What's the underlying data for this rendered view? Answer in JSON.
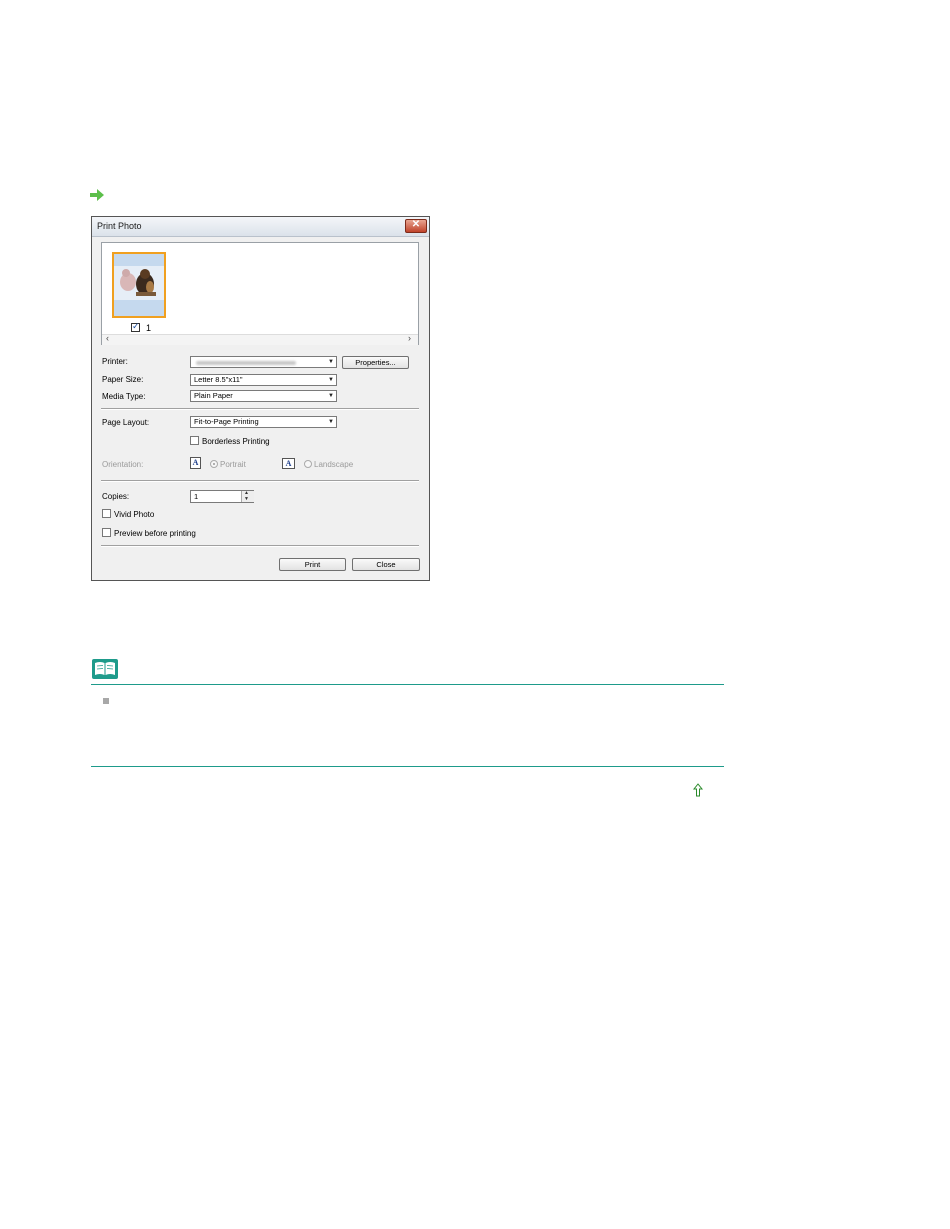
{
  "dialog": {
    "title": "Print Photo",
    "close_glyph": "✕",
    "thumbnail": {
      "number": "1",
      "checked": true,
      "check_glyph": "✓",
      "scroll_left": "‹",
      "scroll_right": "›"
    },
    "printer": {
      "label": "Printer:",
      "value": "",
      "properties_button": "Properties..."
    },
    "paper_size": {
      "label": "Paper Size:",
      "value": "Letter 8.5\"x11\""
    },
    "media_type": {
      "label": "Media Type:",
      "value": "Plain Paper"
    },
    "page_layout": {
      "label": "Page Layout:",
      "value": "Fit-to-Page Printing"
    },
    "borderless": {
      "label": "Borderless Printing",
      "checked": false
    },
    "orientation": {
      "label": "Orientation:",
      "portrait": "Portrait",
      "landscape": "Landscape",
      "icon_letter": "A",
      "selected": "Portrait"
    },
    "copies": {
      "label": "Copies:",
      "value": "1",
      "up": "▲",
      "down": "▼"
    },
    "vivid_photo": {
      "label": "Vivid Photo",
      "checked": false
    },
    "preview": {
      "label": "Preview before printing",
      "checked": false
    },
    "print_button": "Print",
    "close_button": "Close",
    "combo_arrow": "▼"
  },
  "colors": {
    "accent_green": "#5cbf4a",
    "note_line": "#1e9b8b",
    "thumb_border": "#f0a020"
  },
  "icons": {
    "arrow": "green-right-arrow-icon",
    "note": "open-book-note-icon",
    "top": "page-top-arrow-icon"
  }
}
